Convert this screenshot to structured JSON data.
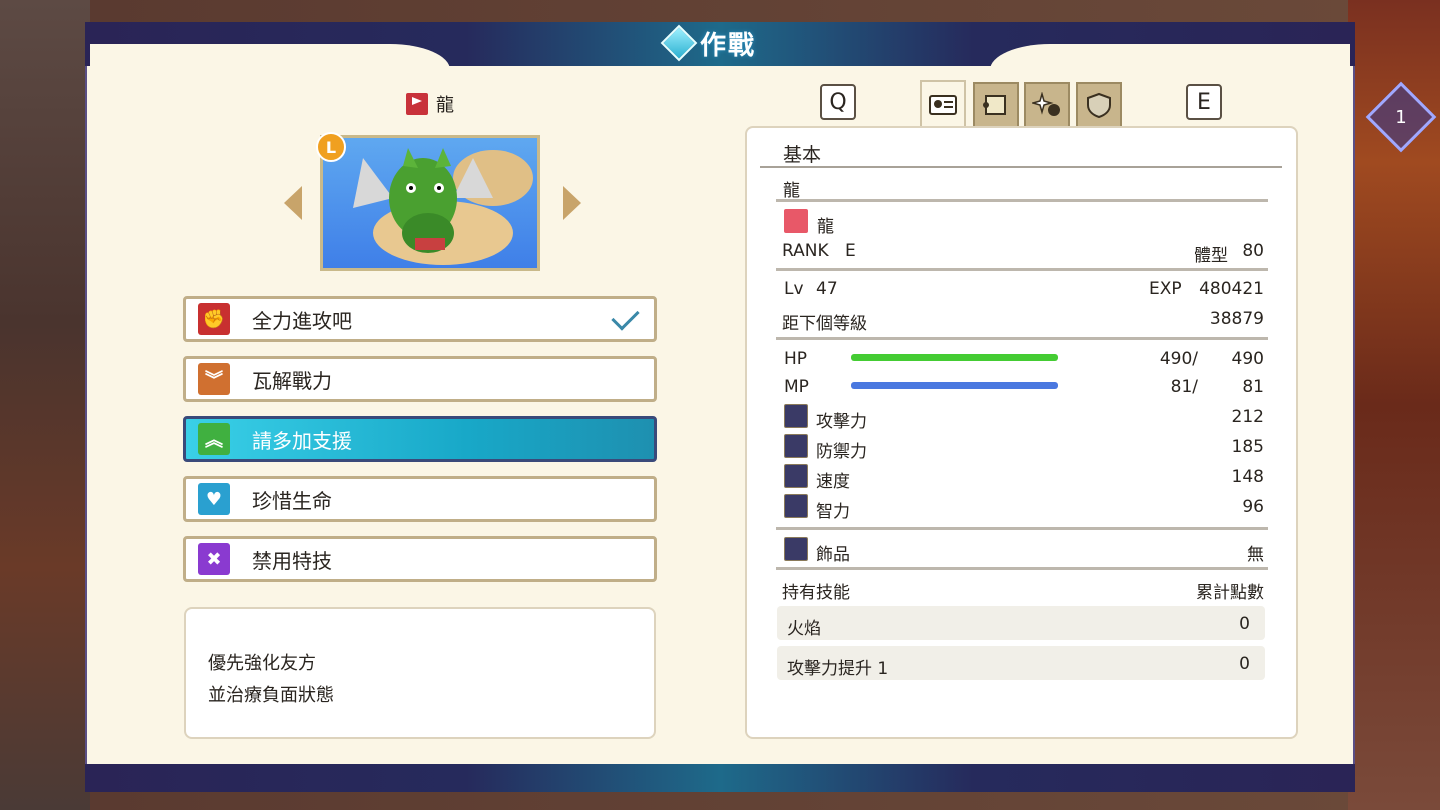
{
  "header": {
    "title": "作戰"
  },
  "monster": {
    "name": "龍",
    "rank_badge": "L"
  },
  "tactics": [
    {
      "label": "全力進攻吧",
      "icon": "fist-icon",
      "color": "#c83030",
      "checked": true
    },
    {
      "label": "瓦解戰力",
      "icon": "double-chevron-down-icon",
      "color": "#d07030"
    },
    {
      "label": "請多加支援",
      "icon": "double-chevron-up-icon",
      "color": "#40b040",
      "selected": true
    },
    {
      "label": "珍惜生命",
      "icon": "heart-icon",
      "color": "#2aa0d0"
    },
    {
      "label": "禁用特技",
      "icon": "cross-pattern-icon",
      "color": "#8a3ad0"
    }
  ],
  "description": {
    "line1": "優先強化友方",
    "line2": "並治療負面狀態"
  },
  "tabs": {
    "prev_key": "Q",
    "next_key": "E"
  },
  "info": {
    "section": "基本",
    "name": "龍",
    "family": "龍",
    "rank_label": "RANK",
    "rank_value": "E",
    "size_label": "體型",
    "size_value": "80",
    "lv_label": "Lv",
    "lv_value": "47",
    "exp_label": "EXP",
    "exp_value": "480421",
    "next_label": "距下個等級",
    "next_value": "38879",
    "hp_label": "HP",
    "hp_cur": "490/",
    "hp_max": "490",
    "mp_label": "MP",
    "mp_cur": "81/",
    "mp_max": "81",
    "atk_label": "攻擊力",
    "atk_value": "212",
    "def_label": "防禦力",
    "def_value": "185",
    "spd_label": "速度",
    "spd_value": "148",
    "int_label": "智力",
    "int_value": "96",
    "acc_label": "飾品",
    "acc_value": "無",
    "skills_label": "持有技能",
    "points_label": "累計點數",
    "skills": [
      {
        "name": "火焰",
        "points": "0"
      },
      {
        "name": "攻擊力提升 1",
        "points": "0"
      }
    ]
  },
  "turn_indicator": "1",
  "colors": {
    "hp_bar": "#44cc33",
    "mp_bar": "#4a78e0",
    "selected": "#1eb0cc"
  }
}
